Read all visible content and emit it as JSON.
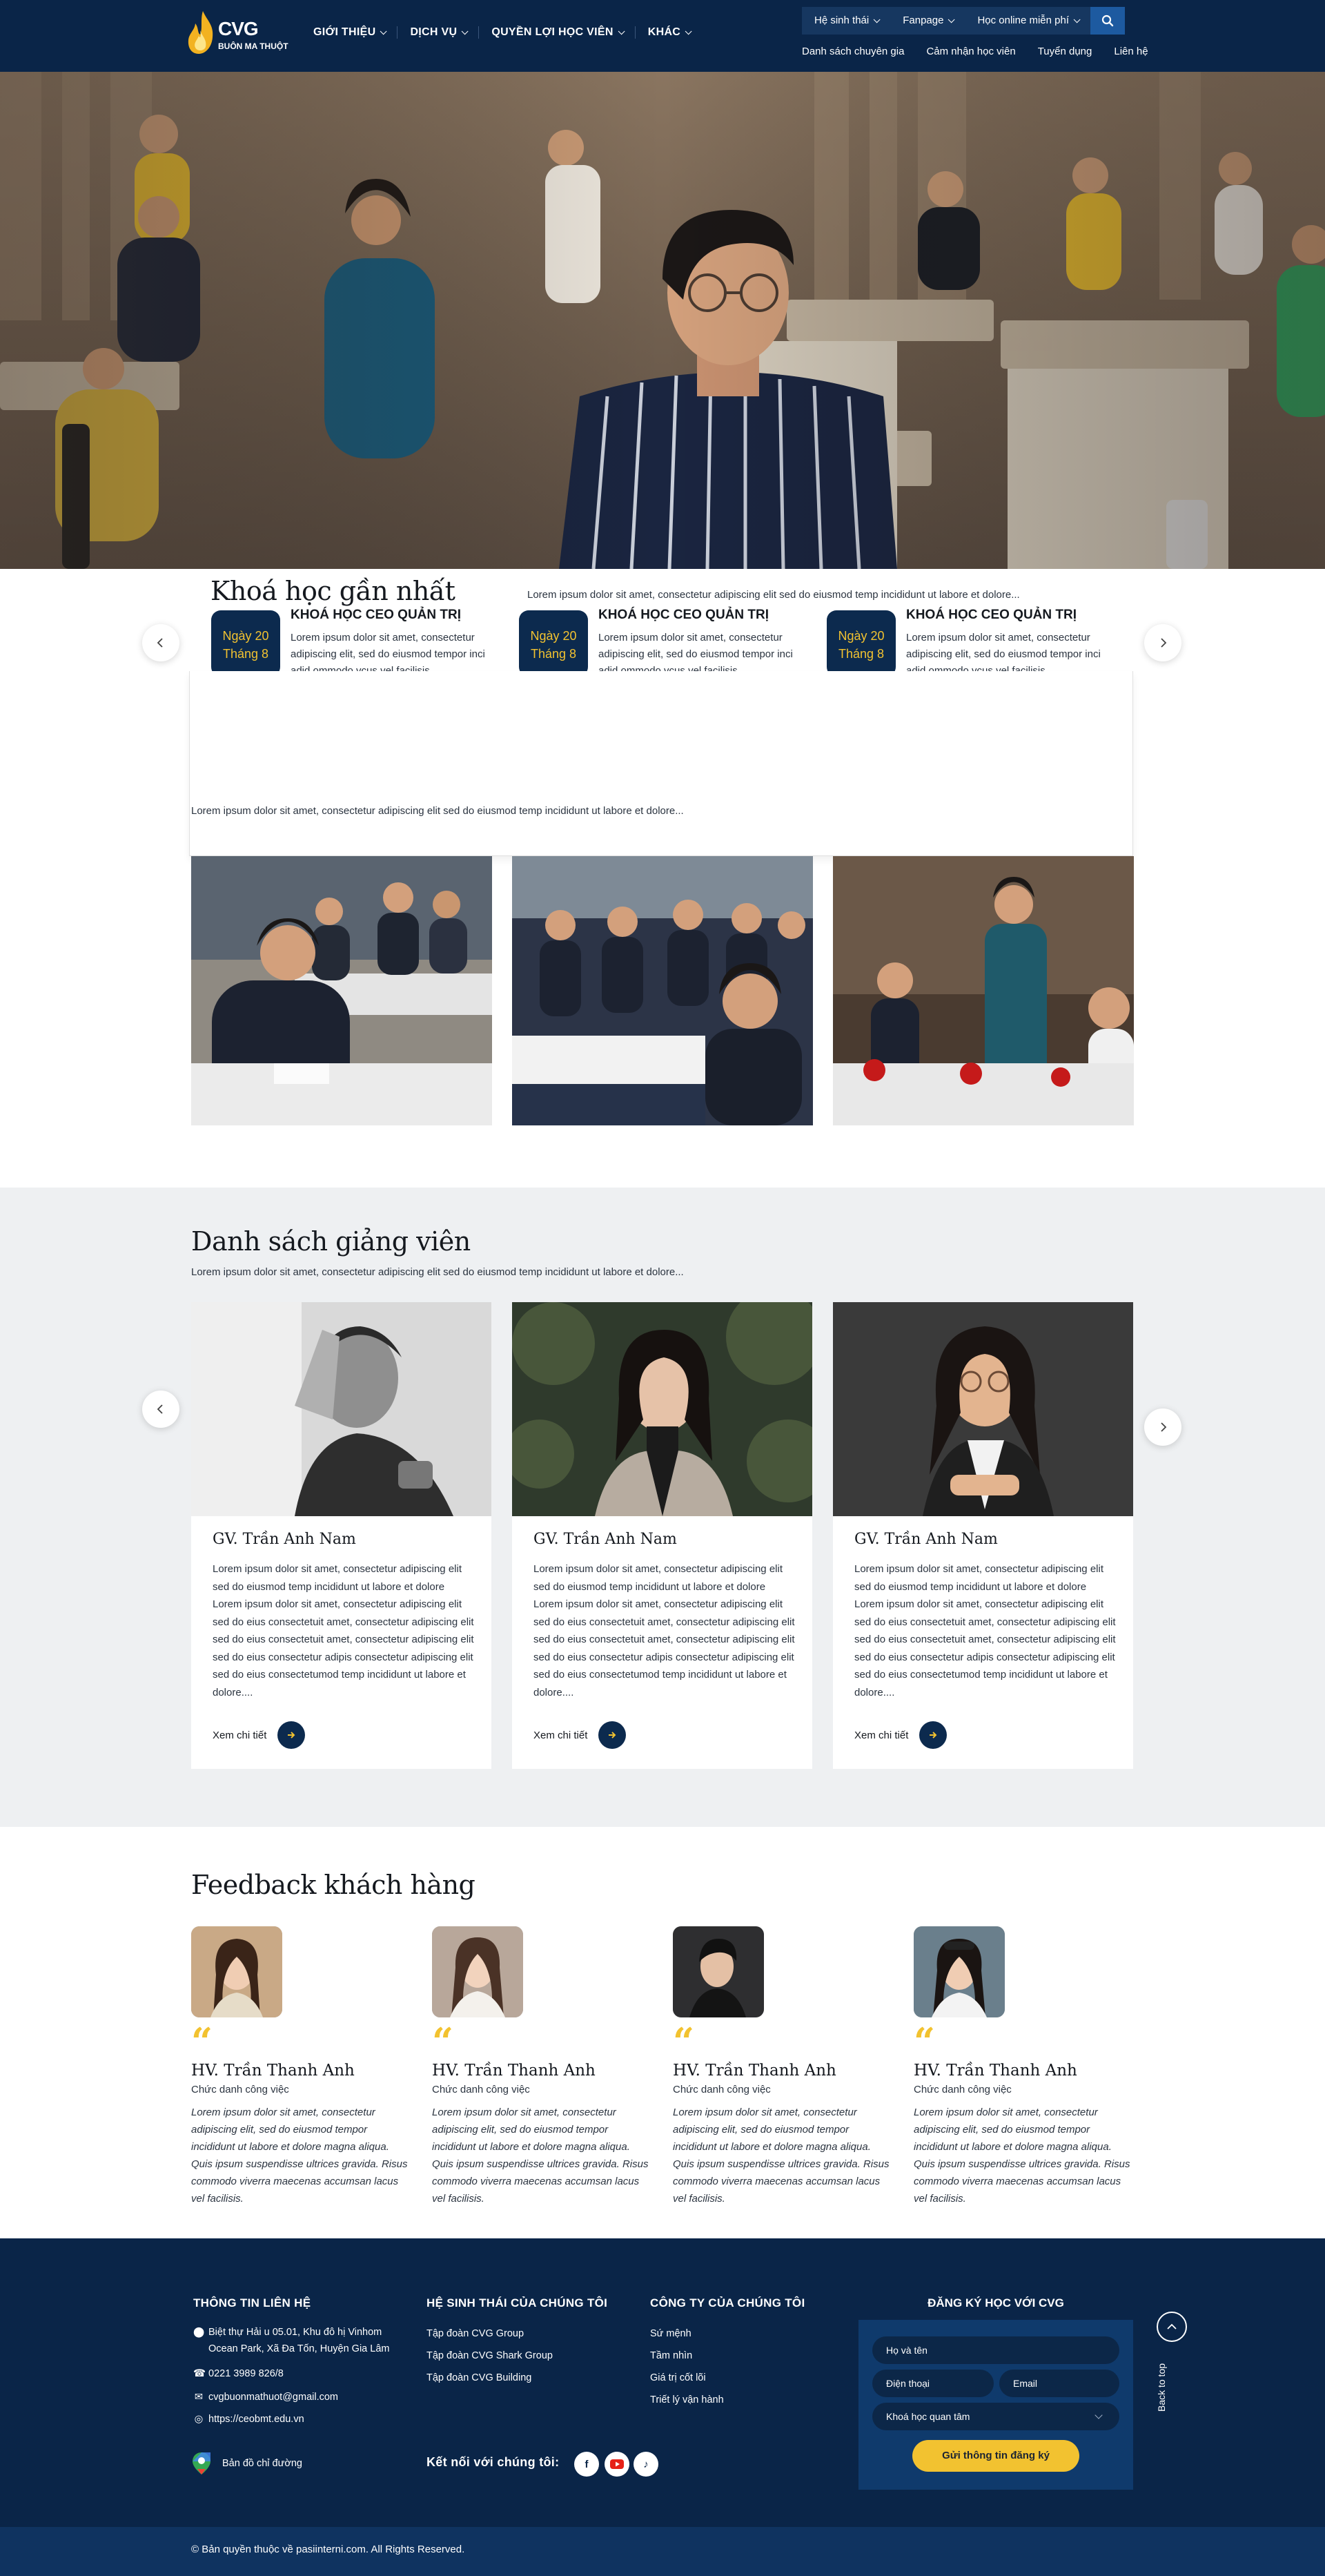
{
  "header": {
    "logo_text": "CVG",
    "logo_sub": "BUÔN MA THUỘT",
    "main_nav": [
      "GIỚI THIỆU",
      "DỊCH VỤ",
      "QUYỀN LỢI HỌC VIÊN",
      "KHÁC"
    ],
    "top_links": [
      "Hệ sinh thái",
      "Fanpage",
      "Học online miễn phí"
    ],
    "sub_nav": [
      "Danh sách chuyên gia",
      "Cảm nhận học viên",
      "Tuyển dụng",
      "Liên hệ"
    ]
  },
  "courses": {
    "title": "Khoá học gần nhất",
    "lead": "Lorem ipsum dolor sit amet, consectetur adipiscing elit sed do eiusmod temp incididunt ut labore et dolore...",
    "items": [
      {
        "date_line1": "Ngày 20",
        "date_line2": "Tháng 8",
        "title": "KHOÁ HỌC CEO QUẢN TRỊ",
        "desc": "Lorem ipsum dolor sit amet, consectetur adipiscing elit, sed do eiusmod tempor inci adid ommodo vcus vel facilisis...."
      },
      {
        "date_line1": "Ngày 20",
        "date_line2": "Tháng 8",
        "title": "KHOÁ HỌC CEO QUẢN TRỊ",
        "desc": "Lorem ipsum dolor sit amet, consectetur adipiscing elit, sed do eiusmod tempor inci adid ommodo vcus vel facilisis...."
      },
      {
        "date_line1": "Ngày 20",
        "date_line2": "Tháng 8",
        "title": "KHOÁ HỌC CEO QUẢN TRỊ",
        "desc": "Lorem ipsum dolor sit amet, consectetur adipiscing elit, sed do eiusmod tempor inci adid ommodo vcus vel facilisis...."
      }
    ],
    "panel_lead": "Lorem ipsum dolor sit amet, consectetur adipiscing elit sed do eiusmod temp incididunt ut labore et dolore..."
  },
  "lecturers": {
    "title": "Danh sách giảng viên",
    "lead": "Lorem ipsum dolor sit amet, consectetur adipiscing elit sed do eiusmod temp incididunt ut labore et dolore...",
    "items": [
      {
        "name": "GV. Trần Anh Nam",
        "desc": "Lorem ipsum dolor sit amet, consectetur adipiscing elit sed do eiusmod temp incididunt ut labore et dolore Lorem ipsum dolor sit amet, consectetur adipiscing elit sed do eius consectetuit amet, consectetur adipiscing elit sed do eius consectetuit amet, consectetur adipiscing elit sed do eius consectetur adipis consectetur adipiscing elit sed do eius consectetumod temp incididunt ut labore et dolore....",
        "more": "Xem chi tiết"
      },
      {
        "name": "GV. Trần Anh Nam",
        "desc": "Lorem ipsum dolor sit amet, consectetur adipiscing elit sed do eiusmod temp incididunt ut labore et dolore Lorem ipsum dolor sit amet, consectetur adipiscing elit sed do eius consectetuit amet, consectetur adipiscing elit sed do eius consectetuit amet, consectetur adipiscing elit sed do eius consectetur adipis consectetur adipiscing elit sed do eius consectetumod temp incididunt ut labore et dolore....",
        "more": "Xem chi tiết"
      },
      {
        "name": "GV. Trần Anh Nam",
        "desc": "Lorem ipsum dolor sit amet, consectetur adipiscing elit sed do eiusmod temp incididunt ut labore et dolore Lorem ipsum dolor sit amet, consectetur adipiscing elit sed do eius consectetuit amet, consectetur adipiscing elit sed do eius consectetuit amet, consectetur adipiscing elit sed do eius consectetur adipis consectetur adipiscing elit sed do eius consectetumod temp incididunt ut labore et dolore....",
        "more": "Xem chi tiết"
      }
    ]
  },
  "feedback": {
    "title": "Feedback khách hàng",
    "items": [
      {
        "name": "HV. Trần Thanh Anh",
        "role": "Chức danh công việc",
        "text": "Lorem ipsum dolor sit amet, consectetur adipiscing elit, sed do eiusmod tempor incididunt ut labore et dolore magna aliqua. Quis ipsum suspendisse ultrices gravida. Risus commodo viverra maecenas accumsan lacus vel facilisis."
      },
      {
        "name": "HV. Trần Thanh Anh",
        "role": "Chức danh công việc",
        "text": "Lorem ipsum dolor sit amet, consectetur adipiscing elit, sed do eiusmod tempor incididunt ut labore et dolore magna aliqua. Quis ipsum suspendisse ultrices gravida. Risus commodo viverra maecenas accumsan lacus vel facilisis."
      },
      {
        "name": "HV. Trần Thanh Anh",
        "role": "Chức danh công việc",
        "text": "Lorem ipsum dolor sit amet, consectetur adipiscing elit, sed do eiusmod tempor incididunt ut labore et dolore magna aliqua. Quis ipsum suspendisse ultrices gravida. Risus commodo viverra maecenas accumsan lacus vel facilisis."
      },
      {
        "name": "HV. Trần Thanh Anh",
        "role": "Chức danh công việc",
        "text": "Lorem ipsum dolor sit amet, consectetur adipiscing elit, sed do eiusmod tempor incididunt ut labore et dolore magna aliqua. Quis ipsum suspendisse ultrices gravida. Risus commodo viverra maecenas accumsan lacus vel facilisis."
      }
    ]
  },
  "footer": {
    "contact_title": "THÔNG TIN LIÊN HỆ",
    "address_1": "Biệt thự Hải  u 05.01, Khu đô hị Vinhom",
    "address_2": "Ocean Park, Xã Đa Tốn, Huyện Gia Lâm",
    "phone": "0221 3989 826/8",
    "email": "cvgbuonmathuot@gmail.com",
    "website": "https://ceobmt.edu.vn",
    "map_label": "Bản đồ chỉ đường",
    "ecosystem_title": "HỆ SINH THÁI CỦA CHÚNG TÔI",
    "ecosystem": [
      "Tập đoàn CVG Group",
      "Tập đoàn CVG Shark Group",
      "Tập đoàn CVG Building"
    ],
    "company_title": "CÔNG TY CỦA CHÚNG TÔI",
    "company": [
      "Sứ mệnh",
      "Tầm nhìn",
      "Giá trị cốt lõi",
      "Triết lý vận hành"
    ],
    "connect_label": "Kết nối với chúng tôi:",
    "register_title": "ĐĂNG KÝ HỌC VỚI CVG",
    "form": {
      "name": "Họ và tên",
      "phone": "Điện thoại",
      "email": "Email",
      "course": "Khoá học quan tâm",
      "submit": "Gửi thông tin đăng ký"
    },
    "back_to_top": "Back to top",
    "copyright": "© Bản quyền thuộc về pasiinterni.com. All Rights Reserved."
  },
  "colors": {
    "navy": "#0a2548",
    "accent": "#f2c230",
    "light_bg": "#eef0f2"
  }
}
